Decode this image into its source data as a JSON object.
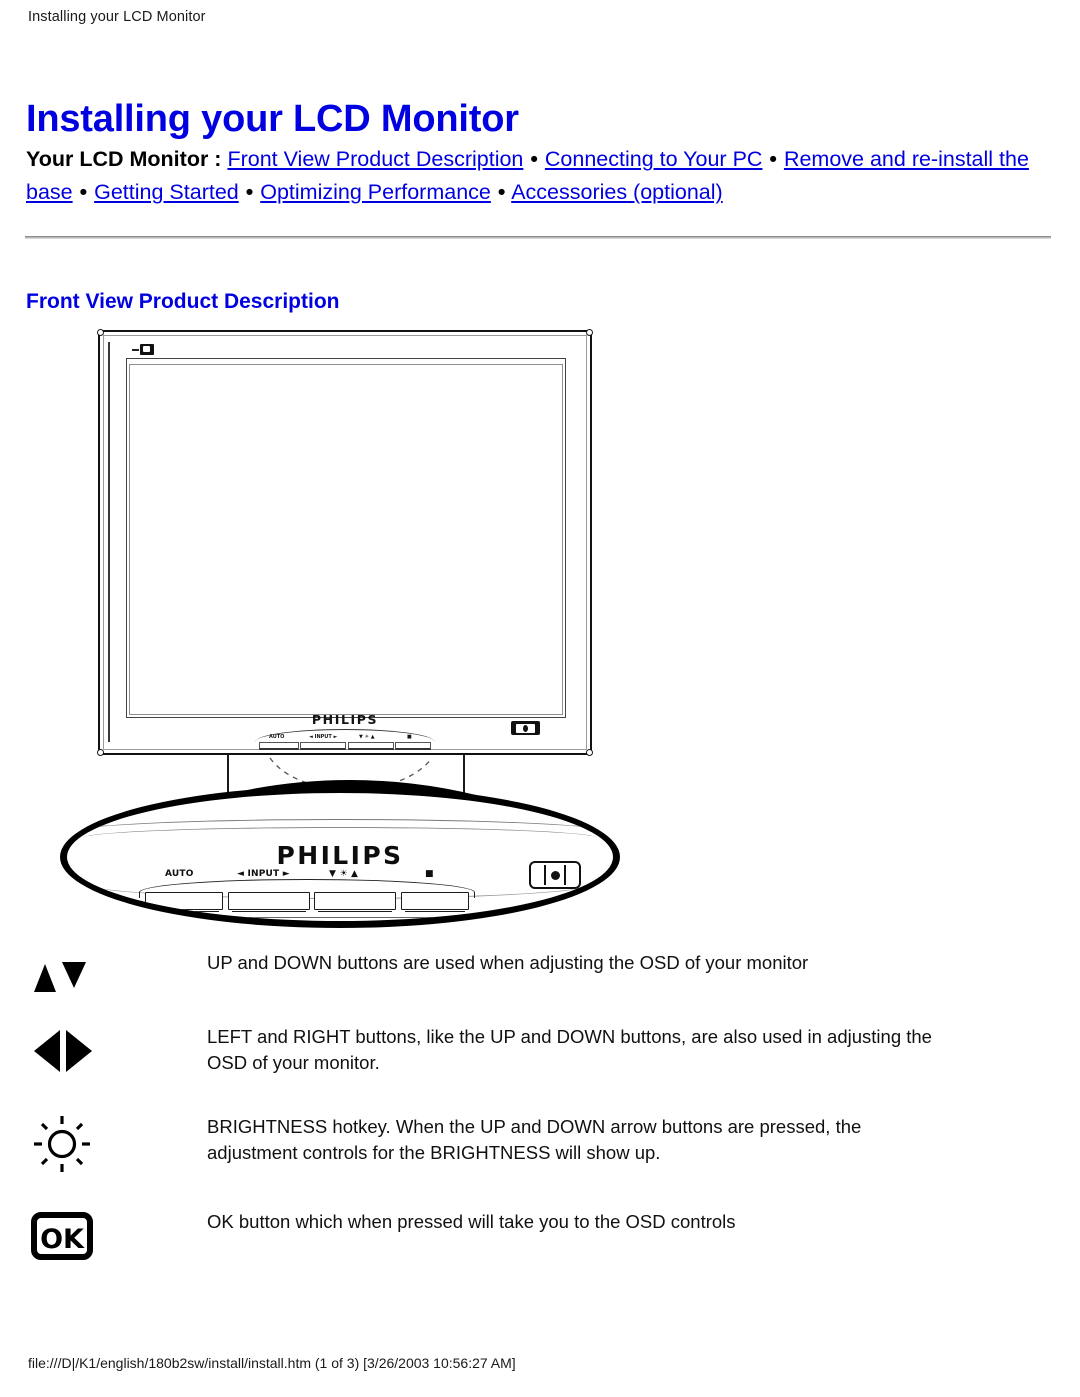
{
  "page_header": "Installing your LCD Monitor",
  "doc_title": "Installing your LCD Monitor",
  "nav": {
    "label": "Your LCD Monitor",
    "colon": " : ",
    "separator": "•",
    "links": [
      "Front View Product Description",
      "Connecting to Your PC",
      "Remove and re-install the base",
      "Getting Started",
      "Optimizing Performance",
      "Accessories (optional)"
    ]
  },
  "section_heading": "Front View Product Description",
  "figure": {
    "bezel_wordmark": "PHILIPS",
    "base_wordmark": "PHILIPS",
    "bezel_badge_name": "philips-badge-icon",
    "keys": [
      {
        "label": "AUTO"
      },
      {
        "label": "◄ INPUT ►"
      },
      {
        "label": "▼ ☀ ▲"
      },
      {
        "label": "■"
      }
    ],
    "power_label": "power-button"
  },
  "descriptions": [
    {
      "icon": "up-down-arrows-icon",
      "text": "UP and DOWN buttons are used when adjusting the OSD of your monitor"
    },
    {
      "icon": "left-right-arrows-icon",
      "text": "LEFT and RIGHT buttons, like the UP and DOWN buttons, are also used in adjusting the OSD of your monitor."
    },
    {
      "icon": "brightness-sun-icon",
      "text": "BRIGHTNESS hotkey. When the UP and DOWN arrow buttons are pressed, the adjustment controls for the BRIGHTNESS will show up."
    },
    {
      "icon": "ok-button-icon",
      "text": "OK button which when pressed will take you to the OSD controls"
    }
  ],
  "footer": "file:///D|/K1/english/180b2sw/install/install.htm (1 of 3) [3/26/2003 10:56:27 AM]",
  "colors": {
    "link": "#0000e0",
    "heading": "#0000e0",
    "text": "#111111",
    "rule": "#8d8d8d"
  }
}
